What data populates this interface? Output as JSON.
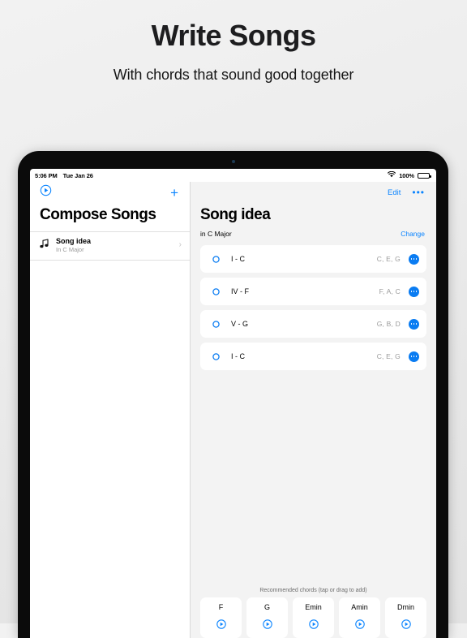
{
  "promo": {
    "title": "Write Songs",
    "subtitle": "With chords that sound good together"
  },
  "statusbar": {
    "time": "5:06 PM",
    "date": "Tue Jan 26",
    "battery_percent": "100%",
    "wifi_icon": "wifi-icon",
    "battery_icon": "battery-icon"
  },
  "sidebar": {
    "play_icon": "play-circle-icon",
    "add_label": "+",
    "title": "Compose Songs",
    "song": {
      "icon": "music-note-icon",
      "name": "Song idea",
      "subtitle": "In C Major",
      "chevron": "chevron-right-icon"
    }
  },
  "detail": {
    "edit_label": "Edit",
    "more_label": "•••",
    "title": "Song idea",
    "key_label": "in C Major",
    "change_label": "Change",
    "chords": [
      {
        "degree": "I - C",
        "notes": "C, E, G"
      },
      {
        "degree": "IV - F",
        "notes": "F, A, C"
      },
      {
        "degree": "V - G",
        "notes": "G, B, D"
      },
      {
        "degree": "I - C",
        "notes": "C, E, G"
      }
    ],
    "recommended_label": "Recommended chords (tap or drag to add)",
    "recommended": [
      {
        "name": "F"
      },
      {
        "name": "G"
      },
      {
        "name": "Emin"
      },
      {
        "name": "Amin"
      },
      {
        "name": "Dmin"
      }
    ]
  },
  "colors": {
    "accent": "#0a84ff",
    "accent_fill": "#0a7cf2",
    "muted": "#9a9a9a",
    "detail_bg": "#f3f3f3"
  }
}
